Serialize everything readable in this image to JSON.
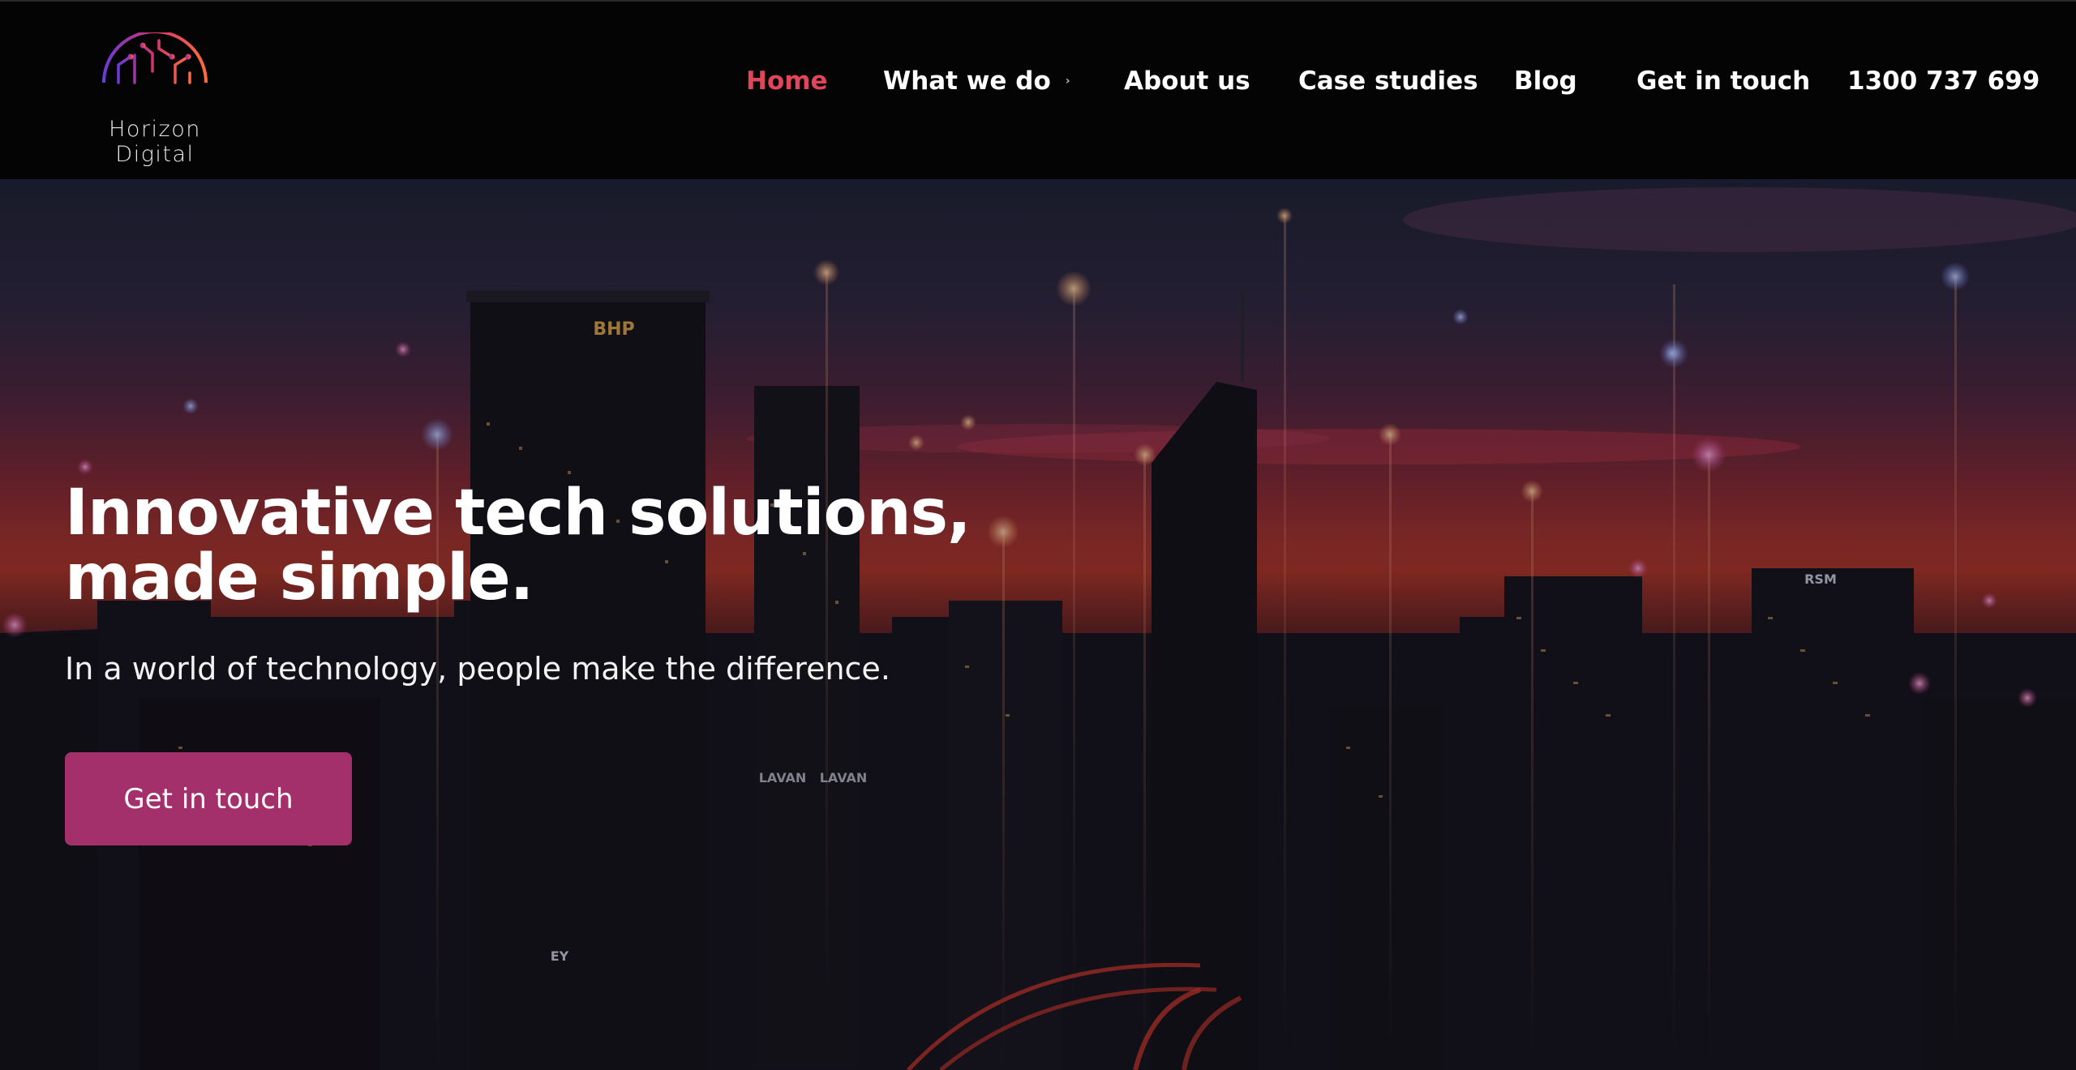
{
  "brand": {
    "name": "Horizon Digital"
  },
  "nav": {
    "items": [
      {
        "label": "Home",
        "active": true
      },
      {
        "label": "What we do",
        "has_dropdown": true
      },
      {
        "label": "About us"
      },
      {
        "label": "Case studies"
      },
      {
        "label": "Blog"
      },
      {
        "label": "Get in touch"
      },
      {
        "label": "1300 737 699"
      }
    ]
  },
  "hero": {
    "title_line1": "Innovative tech solutions,",
    "title_line2": "made simple.",
    "subtitle": "In a world of technology, people make the difference.",
    "cta_label": "Get in touch",
    "signage": [
      "BHP",
      "LAVAN",
      "LAVAN",
      "RSM",
      "EY"
    ]
  },
  "colors": {
    "accent": "#e0455a",
    "cta": "#a3306b",
    "header_bg": "#040404"
  }
}
